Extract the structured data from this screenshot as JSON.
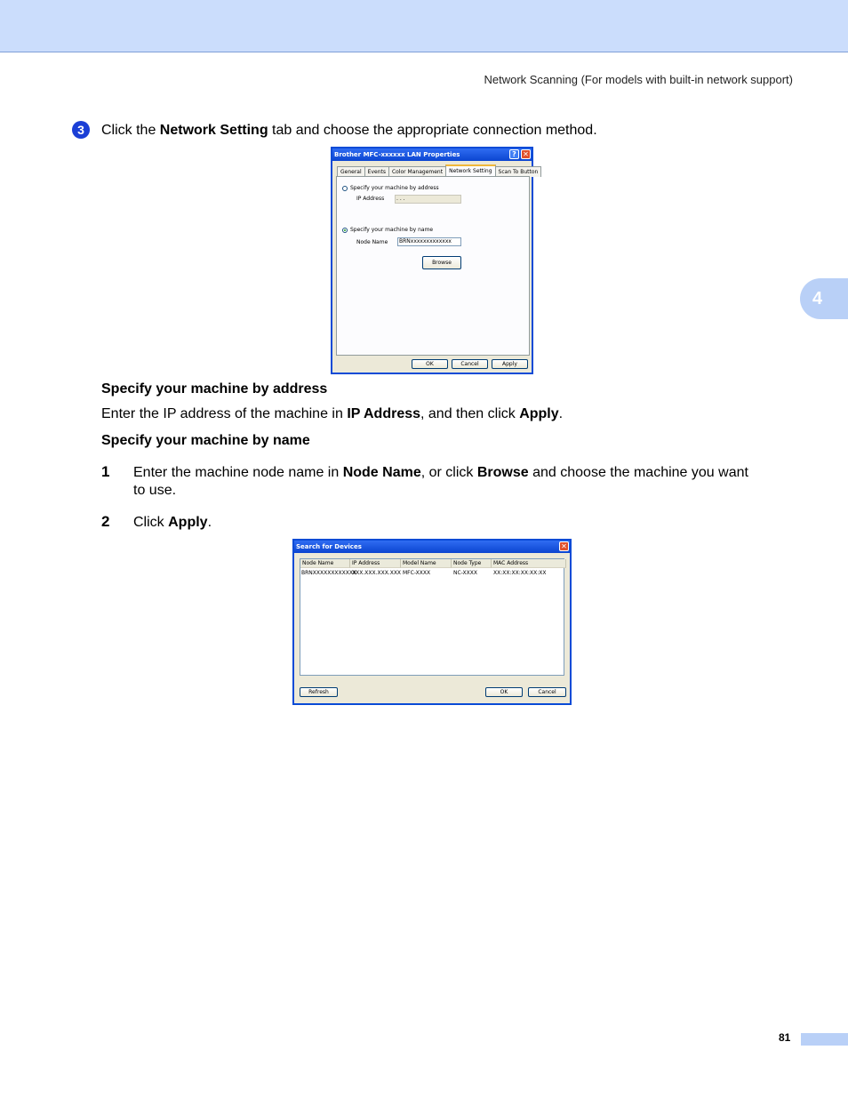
{
  "header": {
    "running_title": "Network Scanning (For models with built-in network support)",
    "chapter_number": "4"
  },
  "step3": {
    "marker": "3",
    "text_before": "Click the ",
    "bold": "Network Setting",
    "text_after": " tab and choose the appropriate connection method."
  },
  "lan_dialog": {
    "title": "Brother MFC-xxxxxx  LAN Properties",
    "help_glyph": "?",
    "close_glyph": "✕",
    "tabs": [
      "General",
      "Events",
      "Color Management",
      "Network Setting",
      "Scan To Button"
    ],
    "active_tab": "Network Setting",
    "radio_address": "Specify your machine by address",
    "ip_label": "IP Address",
    "ip_value": ". . .",
    "radio_name": "Specify your machine by name",
    "node_label": "Node Name",
    "node_value": "BRNxxxxxxxxxxxxx",
    "browse_label": "Browse",
    "ok_label": "OK",
    "cancel_label": "Cancel",
    "apply_label": "Apply"
  },
  "section_address": {
    "heading": "Specify your machine by address",
    "text_before": "Enter the IP address of the machine in ",
    "bold1": "IP Address",
    "text_mid": ", and then click ",
    "bold2": "Apply",
    "text_after": "."
  },
  "section_name": {
    "heading": "Specify your machine by name",
    "items": [
      {
        "number": "1",
        "text_before": "Enter the machine node name in ",
        "bold1": "Node Name",
        "text_mid": ", or click ",
        "bold2": "Browse",
        "text_after": " and choose the machine you want",
        "line2": "to use."
      },
      {
        "number": "2",
        "text_before": "Click ",
        "bold1": "Apply",
        "text_after": "."
      }
    ]
  },
  "search_dialog": {
    "title": "Search for Devices",
    "close_glyph": "✕",
    "columns": [
      "Node Name",
      "IP Address",
      "Model Name",
      "Node Type",
      "MAC Address"
    ],
    "row": [
      "BRNXXXXXXXXXXXX",
      "XXX.XXX.XXX.XXX",
      "MFC-XXXX",
      "NC-XXXX",
      "XX:XX:XX:XX:XX:XX"
    ],
    "refresh_label": "Refresh",
    "ok_label": "OK",
    "cancel_label": "Cancel"
  },
  "footer": {
    "page_number": "81"
  }
}
